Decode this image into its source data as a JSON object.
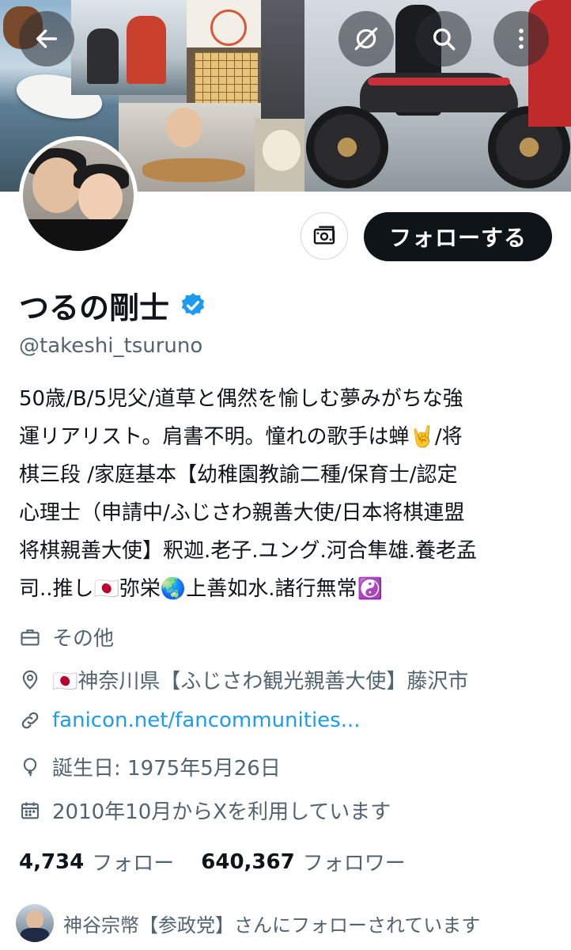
{
  "header": {
    "back_label": "戻る",
    "grok_label": "Grok",
    "search_label": "検索",
    "more_label": "その他"
  },
  "profile": {
    "display_name": "つるの剛士",
    "handle": "@takeshi_tsuruno",
    "verified": true,
    "follow_button": "フォローする",
    "bio_lines": [
      "50歳/B/5児父/道草と偶然を愉しむ夢みがちな強",
      "運リアリスト。肩書不明。憧れの歌手は蝉🤘/将",
      "棋三段 /家庭基本【幼稚園教諭二種/保育士/認定",
      "心理士（申請中/ふじさわ親善大使/日本将棋連盟",
      "将棋親善大使】釈迦.老子.ユング.河合隼雄.養老孟",
      "司..推し🇯🇵弥栄🌏上善如水.諸行無常☯️"
    ],
    "category": "その他",
    "location": "🇯🇵神奈川県【ふじさわ観光親善大使】藤沢市",
    "url": "fanicon.net/fancommunities...",
    "birthday": "誕生日: 1975年5月26日",
    "joined": "2010年10月からXを利用しています"
  },
  "stats": {
    "following_count": "4,734",
    "following_label": "フォロー",
    "followers_count": "640,367",
    "followers_label": "フォロワー"
  },
  "followed_by": {
    "text": "神谷宗幣【参政党】さんにフォローされています"
  },
  "colors": {
    "link": "#1d9bf0",
    "verified": "#1d9bf0",
    "secondary_text": "#536471",
    "primary_text": "#0f1419"
  }
}
